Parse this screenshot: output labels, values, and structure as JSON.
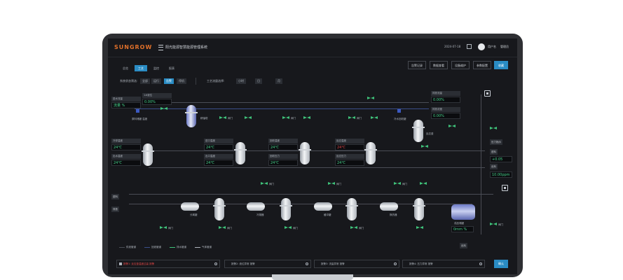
{
  "brand": {
    "logo": "SUNGROW",
    "system_title": "阳光能源智慧能源管理系统"
  },
  "header": {
    "date": "2024-07-18",
    "user_label": "用户名",
    "user_name": "管理员"
  },
  "tabs": [
    "总览",
    "工艺",
    "监控",
    "报表"
  ],
  "actions": [
    "告警记录",
    "数据查看",
    "设备维护",
    "参数配置",
    "收藏"
  ],
  "filters": {
    "label_a": "系统状态筛选:",
    "chips_a": [
      "全部",
      "运行",
      "告警",
      "停机"
    ],
    "label_b": "工艺流量选择:",
    "chips_b": [
      "小时",
      "日",
      "月"
    ]
  },
  "panels": [
    {
      "label": "1#液位",
      "value": "0.00%"
    },
    {
      "label": "液位计/温度",
      "value": "-- 24℃",
      "red": false
    },
    {
      "label": "进水流量",
      "value": "0.00%"
    },
    {
      "label": "出水流量",
      "value": "24℃"
    },
    {
      "label": "冷却温度",
      "value": "24℃"
    },
    {
      "label": "出水温度",
      "value": "24℃"
    },
    {
      "label": "进口温度",
      "value": "24℃"
    },
    {
      "label": "出口温度",
      "value": "24℃"
    },
    {
      "label": "回收温度",
      "value": "24℃"
    },
    {
      "label": "回收压力",
      "value": "24℃"
    },
    {
      "label": "反应温度",
      "value": "24℃",
      "red": true
    },
    {
      "label": "反应压力",
      "value": "24℃"
    },
    {
      "label": "排放流量",
      "value": "0.00%"
    },
    {
      "label": "排放浓度",
      "value": "0.00%"
    }
  ],
  "side_labels": {
    "top_left": "流量 %",
    "right_top": "+0.05",
    "right_mid": "+0.05",
    "right_value": "10.00ppm",
    "right_chip": "压力指示",
    "bottom_value": "0mm %"
  },
  "misc_labels": {
    "feed": "原料储罐 温度",
    "water": "冷水回收罐",
    "storage": "成品储罐",
    "pipe_in": "进料",
    "pipe_out": "出料",
    "pipe_exhaust": "排放",
    "tank_1": "精馏塔",
    "tank_2": "反应釜",
    "tank_3": "分离罐",
    "tank_4": "冷凝器",
    "tank_5": "缓冲罐",
    "tank_6": "换热器",
    "valve_short": "阀门"
  },
  "legend": [
    "供液管道",
    "回液管道",
    "排水管道",
    "气体管道"
  ],
  "alarms": [
    {
      "text": "报警1: 反应釜温度过高 报警",
      "red": true
    },
    {
      "text": "报警2: 液位异常 报警",
      "red": false
    },
    {
      "text": "报警3: 流量异常 报警",
      "red": false
    },
    {
      "text": "报警4: 压力异常 报警",
      "red": false
    }
  ],
  "confirm_label": "确认"
}
